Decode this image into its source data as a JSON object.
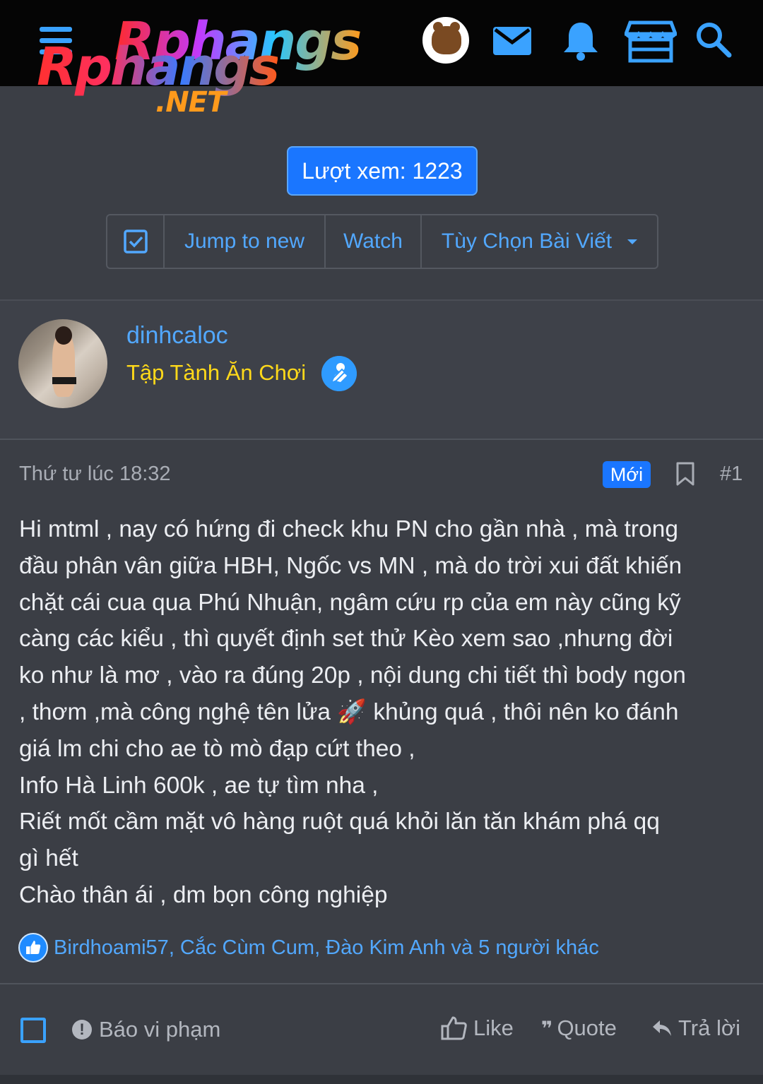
{
  "header": {
    "logo_line1": "Rphangs",
    "logo_line2": "Rphangs",
    "logo_suffix": ".NET",
    "icons": [
      "menu-icon",
      "bear-avatar",
      "mail-icon",
      "bell-icon",
      "store-icon",
      "search-icon"
    ],
    "accent": "#3aa2ff"
  },
  "views": {
    "label": "Lượt xem: 1223"
  },
  "toolbar": {
    "jump_label": "Jump to new",
    "watch_label": "Watch",
    "options_label": "Tùy Chọn Bài Viết"
  },
  "user": {
    "name": "dinhcaloc",
    "title": "Tập Tành Ăn Chơi"
  },
  "post": {
    "time": "Thứ tư lúc 18:32",
    "new_badge": "Mới",
    "number": "#1",
    "lines": [
      "Hi mtml , nay có hứng đi check khu PN cho gần nhà , mà trong",
      "đầu phân vân giữa HBH, Ngốc vs MN , mà do trời xui đất khiến",
      "chặt cái cua qua Phú Nhuận, ngâm cứu rp của em này cũng kỹ",
      "càng các kiểu , thì quyết định set thử Kèo xem sao ,nhưng đời",
      "ko như là mơ , vào ra đúng 20p , nội dung chi tiết thì body ngon",
      ", thơm ,mà công nghệ tên lửa 🚀 khủng quá , thôi nên ko đánh",
      "giá lm chi cho ae tò mò đạp cứt theo ,",
      "Info Hà Linh 600k , ae tự tìm nha ,",
      "Riết mốt cầm mặt vô hàng ruột quá khỏi lăn tăn khám phá qq",
      "gì hết",
      "Chào thân ái , dm bọn công nghiệp"
    ],
    "likes_text": "Birdhoami57, Cắc Cùm Cum, Đào Kim Anh và 5 người khác"
  },
  "footer": {
    "report_label": "Báo vi phạm",
    "like_label": "Like",
    "quote_label": "Quote",
    "reply_label": "Trả lời"
  }
}
